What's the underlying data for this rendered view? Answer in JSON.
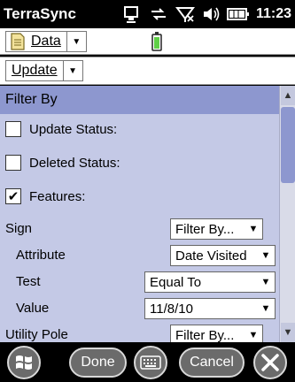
{
  "status_bar": {
    "app_title": "TerraSync",
    "time": "11:23",
    "icons": [
      "connectivity-icon",
      "sync-icon",
      "no-signal-icon",
      "volume-icon",
      "battery-icon"
    ]
  },
  "menus": {
    "data_label": "Data",
    "update_label": "Update"
  },
  "panel": {
    "header": "Filter By",
    "checkboxes": [
      {
        "label": "Update Status:",
        "checked": false
      },
      {
        "label": "Deleted Status:",
        "checked": false
      },
      {
        "label": "Features:",
        "checked": true
      }
    ],
    "fields": [
      {
        "label": "Sign",
        "value": "Filter By..."
      },
      {
        "label": "Attribute",
        "value": "Date Visited"
      },
      {
        "label": "Test",
        "value": "Equal To"
      },
      {
        "label": "Value",
        "value": "11/8/10"
      },
      {
        "label": "Utility Pole",
        "value": "Filter By..."
      }
    ]
  },
  "bottom_bar": {
    "done_label": "Done",
    "cancel_label": "Cancel"
  },
  "colors": {
    "panel_bg": "#c4c9e6",
    "header_bg": "#8d97cf"
  }
}
